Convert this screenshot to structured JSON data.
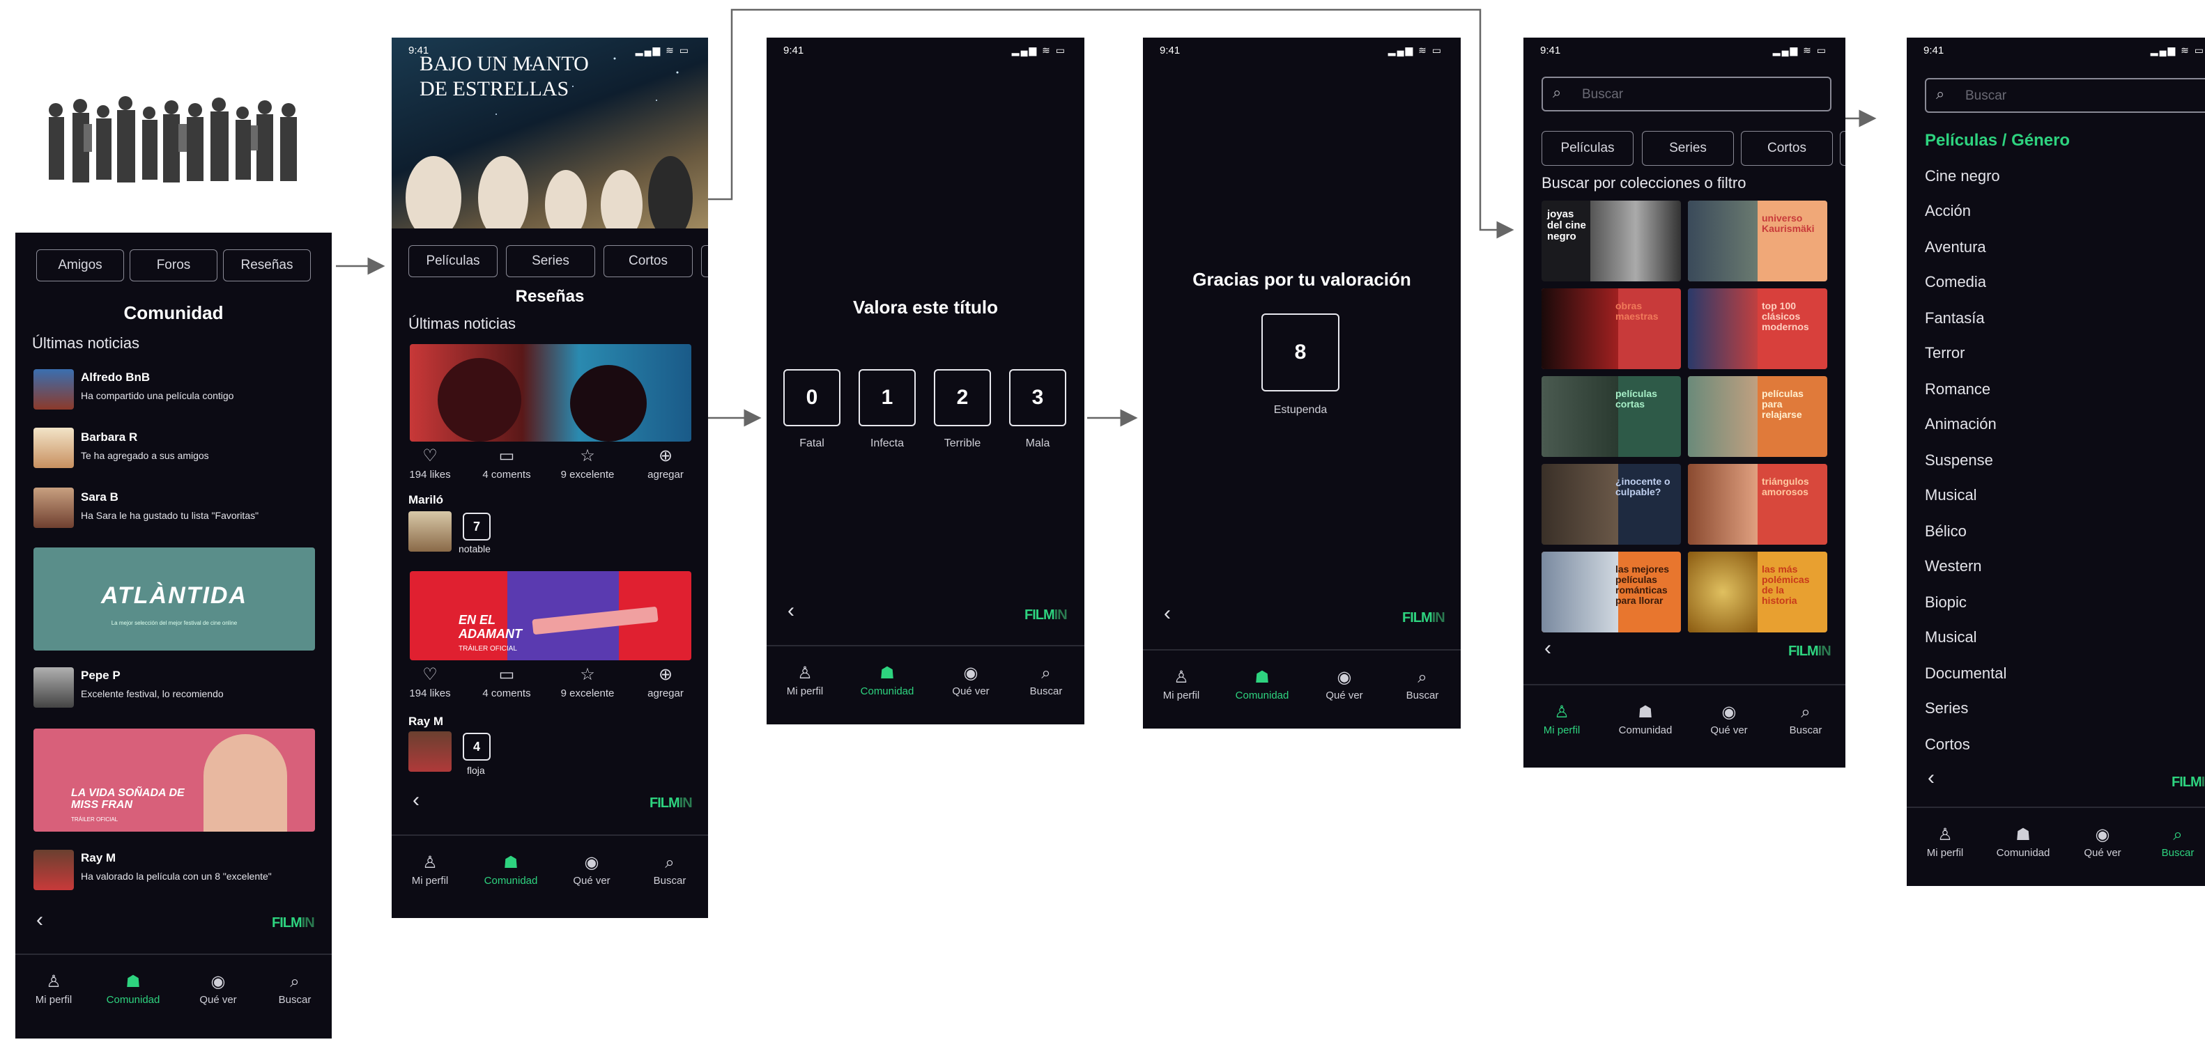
{
  "colors": {
    "accent": "#2ed37f",
    "screen_bg": "#0c0b14",
    "arrow": "#666666"
  },
  "status": {
    "time": "9:41",
    "icons": "▂▄▆ ≋ ▭"
  },
  "nav": [
    {
      "icon": "person-icon",
      "glyph": "♙",
      "label": "Mi perfil"
    },
    {
      "icon": "community-icon",
      "glyph": "☗",
      "label": "Comunidad"
    },
    {
      "icon": "eye-icon",
      "glyph": "◉",
      "label": "Qué ver"
    },
    {
      "icon": "search-icon",
      "glyph": "⌕",
      "label": "Buscar"
    }
  ],
  "logo": {
    "text": "FILM",
    "suffix": "IN"
  },
  "back": "‹",
  "screen1": {
    "tabs": [
      "Amigos",
      "Foros",
      "Reseñas"
    ],
    "title": "Comunidad",
    "section": "Últimas noticias",
    "feed": [
      {
        "name": "Alfredo BnB",
        "text": "Ha compartido una película contigo"
      },
      {
        "name": "Barbara R",
        "text": "Te ha agregado a sus amigos"
      },
      {
        "name": "Sara B",
        "text": "Ha Sara le ha gustado tu lista \"Favoritas\""
      },
      {
        "name": "Pepe P",
        "text": "Excelente festival, lo recomiendo"
      },
      {
        "name": "Ray M",
        "text": "Ha valorado la película con un 8 \"excelente\""
      }
    ],
    "banner1": {
      "title": "ATLÀNTIDA",
      "sub": "La mejor selección del mejor festival de cine online"
    },
    "banner2": {
      "title": "LA VIDA SOÑADA DE MISS FRAN",
      "sub": "TRÁILER OFICIAL"
    },
    "active_nav": 1
  },
  "screen2": {
    "hero_title": "BAJO UN MANTO DE ESTRELLAS",
    "tabs": [
      "Películas",
      "Series",
      "Cortos"
    ],
    "title": "Reseñas",
    "section": "Últimas noticias",
    "actions": [
      {
        "icon": "heart-icon",
        "glyph": "♡",
        "label": "194 likes"
      },
      {
        "icon": "comment-icon",
        "glyph": "▭",
        "label": "4 coments"
      },
      {
        "icon": "star-icon",
        "glyph": "☆",
        "label": "9 excelente"
      },
      {
        "icon": "add-icon",
        "glyph": "⊕",
        "label": "agregar"
      }
    ],
    "review1": {
      "name": "Mariló",
      "score": "7",
      "word": "notable"
    },
    "banner2": {
      "title": "EN EL ADAMANT",
      "sub": "TRÁILER OFICIAL"
    },
    "review2": {
      "name": "Ray M",
      "score": "4",
      "word": "floja"
    },
    "active_nav": 1
  },
  "screen3": {
    "title": "Valora este título",
    "ratings": [
      {
        "score": "0",
        "label": "Fatal"
      },
      {
        "score": "1",
        "label": "Infecta"
      },
      {
        "score": "2",
        "label": "Terrible"
      },
      {
        "score": "3",
        "label": "Mala"
      }
    ],
    "active_nav": 1
  },
  "screen4": {
    "title": "Gracias por tu valoración",
    "score": "8",
    "label": "Estupenda",
    "active_nav": 1
  },
  "screen5": {
    "search_placeholder": "Buscar",
    "tabs": [
      "Películas",
      "Series",
      "Cortos"
    ],
    "section": "Buscar por colecciones o filtro",
    "tiles": [
      {
        "left": "joyas del cine negro",
        "right": "",
        "color": "#1a1a1e"
      },
      {
        "left": "",
        "right": "universo Kaurismäki",
        "color": "#f0a878"
      },
      {
        "left": "",
        "right": "obras maestras",
        "color": "#c83a3a"
      },
      {
        "left": "",
        "right": "top 100 clásicos modernos",
        "color": "#d8403c"
      },
      {
        "left": "",
        "right": "películas cortas",
        "color": "#2e5a48"
      },
      {
        "left": "",
        "right": "películas para relajarse",
        "color": "#e07a3a"
      },
      {
        "left": "",
        "right": "¿inocente o culpable?",
        "color": "#1e2a40"
      },
      {
        "left": "",
        "right": "triángulos amorosos",
        "color": "#d8483c"
      },
      {
        "left": "",
        "right": "las mejores películas románticas para llorar",
        "color": "#e8762e"
      },
      {
        "left": "",
        "right": "las más polémicas de la historia",
        "color": "#e8a030"
      }
    ],
    "active_nav": 0
  },
  "screen6": {
    "search_placeholder": "Buscar",
    "heading": "Películas / Género",
    "genres": [
      "Cine negro",
      "Acción",
      "Aventura",
      "Comedia",
      "Fantasía",
      "Terror",
      "Romance",
      "Animación",
      "Suspense",
      "Musical",
      "Bélico",
      "Western",
      "Biopic",
      "Musical",
      "Documental",
      "Series",
      "Cortos"
    ],
    "active_nav": 3
  }
}
